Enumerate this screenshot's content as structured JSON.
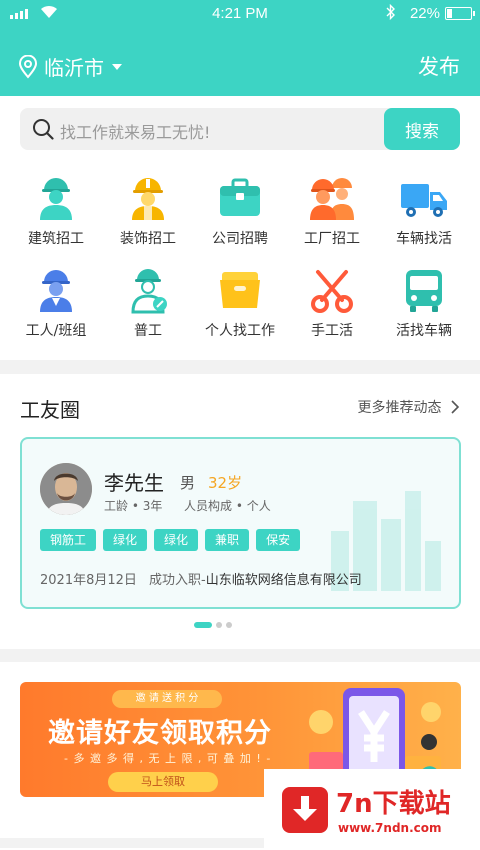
{
  "status_bar": {
    "time": "4:21 PM",
    "battery": "22%",
    "battery_level": 0.22
  },
  "header": {
    "city": "临沂市",
    "publish_label": "发布"
  },
  "search": {
    "placeholder": "找工作就来易工无忧!",
    "button_label": "搜索"
  },
  "categories": [
    {
      "label": "建筑招工",
      "icon": "construction-worker-icon"
    },
    {
      "label": "装饰招工",
      "icon": "decoration-worker-icon"
    },
    {
      "label": "公司招聘",
      "icon": "briefcase-icon"
    },
    {
      "label": "工厂招工",
      "icon": "factory-workers-icon"
    },
    {
      "label": "车辆找活",
      "icon": "truck-icon"
    },
    {
      "label": "工人/班组",
      "icon": "worker-team-icon"
    },
    {
      "label": "普工",
      "icon": "general-worker-icon"
    },
    {
      "label": "个人找工作",
      "icon": "folder-icon"
    },
    {
      "label": "手工活",
      "icon": "scissors-icon"
    },
    {
      "label": "活找车辆",
      "icon": "bus-icon"
    }
  ],
  "circle": {
    "title": "工友圈",
    "more_label": "更多推荐动态",
    "card": {
      "name": "李先生",
      "gender": "男",
      "age": "32岁",
      "seniority": "工龄 • 3年",
      "composition": "人员构成 • 个人",
      "tags": [
        "钢筋工",
        "绿化",
        "绿化",
        "兼职",
        "保安"
      ],
      "record_date": "2021年8月12日",
      "record_action": "成功入职-",
      "record_company": "山东临软网络信息有限公司"
    }
  },
  "banner": {
    "ribbon": "邀 请 送 积 分",
    "title": "邀请好友领取积分",
    "subtitle": "- 多 邀 多 得 , 无 上 限 , 可 叠 加 ! -",
    "button": "马上领取"
  },
  "watermark": {
    "title": "7n下载站",
    "url": "www.7ndn.com"
  },
  "colors": {
    "accent": "#3dd4c4",
    "orange": "#f5a623",
    "banner": "#ff8a34",
    "watermark": "#e02727"
  }
}
